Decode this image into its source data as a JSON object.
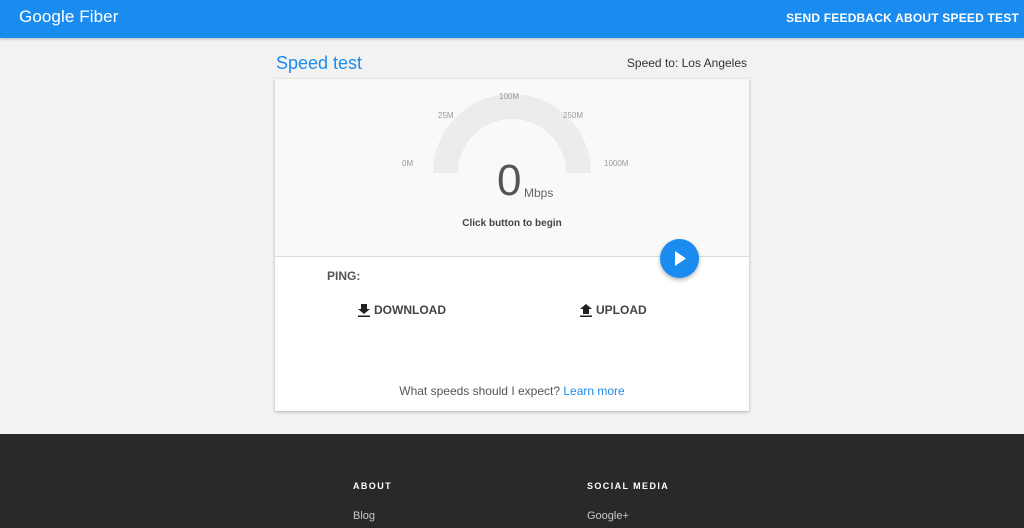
{
  "header": {
    "brand": "Google Fiber",
    "feedback_label": "SEND FEEDBACK ABOUT SPEED TEST"
  },
  "page": {
    "title": "Speed test",
    "speed_to": "Speed to: Los Angeles"
  },
  "gauge": {
    "ticks": [
      "0M",
      "25M",
      "100M",
      "250M",
      "1000M"
    ],
    "value": "0",
    "unit": "Mbps",
    "level": 0,
    "hint": "Click button to begin"
  },
  "results": {
    "ping_label": "PING:",
    "download_label": "DOWNLOAD",
    "upload_label": "UPLOAD"
  },
  "expect": {
    "question": "What speeds should I expect?",
    "link_label": "Learn more"
  },
  "footer": {
    "about_heading": "ABOUT",
    "about_link": "Blog",
    "social_heading": "SOCIAL MEDIA",
    "social_link": "Google+"
  },
  "colors": {
    "accent": "#1a8cf0",
    "footer_bg": "#292929"
  },
  "icons": {
    "play": "play-icon",
    "download": "download-icon",
    "upload": "upload-icon"
  }
}
